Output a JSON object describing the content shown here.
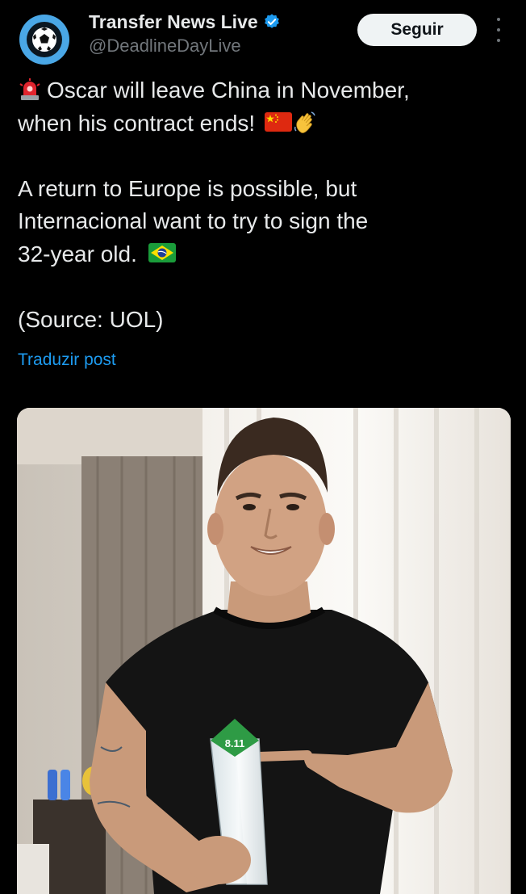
{
  "account": {
    "display_name": "Transfer News Live",
    "handle": "@DeadlineDayLive",
    "verified": true,
    "avatar_icon": "soccer-ball-icon"
  },
  "follow_label": "Seguir",
  "tweet": {
    "line1": "Oscar will leave China in November,",
    "line2": "when his contract ends!",
    "line3": "A return to Europe is possible, but",
    "line4": "Internacional want to try to sign the",
    "line5": "32-year old.",
    "line6": "(Source: UOL)"
  },
  "translate_label": "Traduzir post",
  "media": {
    "trophy_rating": "8.11"
  },
  "colors": {
    "background": "#000000",
    "text": "#e7e9ea",
    "secondary": "#71767b",
    "link": "#1d9bf0",
    "verified": "#1d9bf0",
    "button_bg": "#eff3f4"
  }
}
